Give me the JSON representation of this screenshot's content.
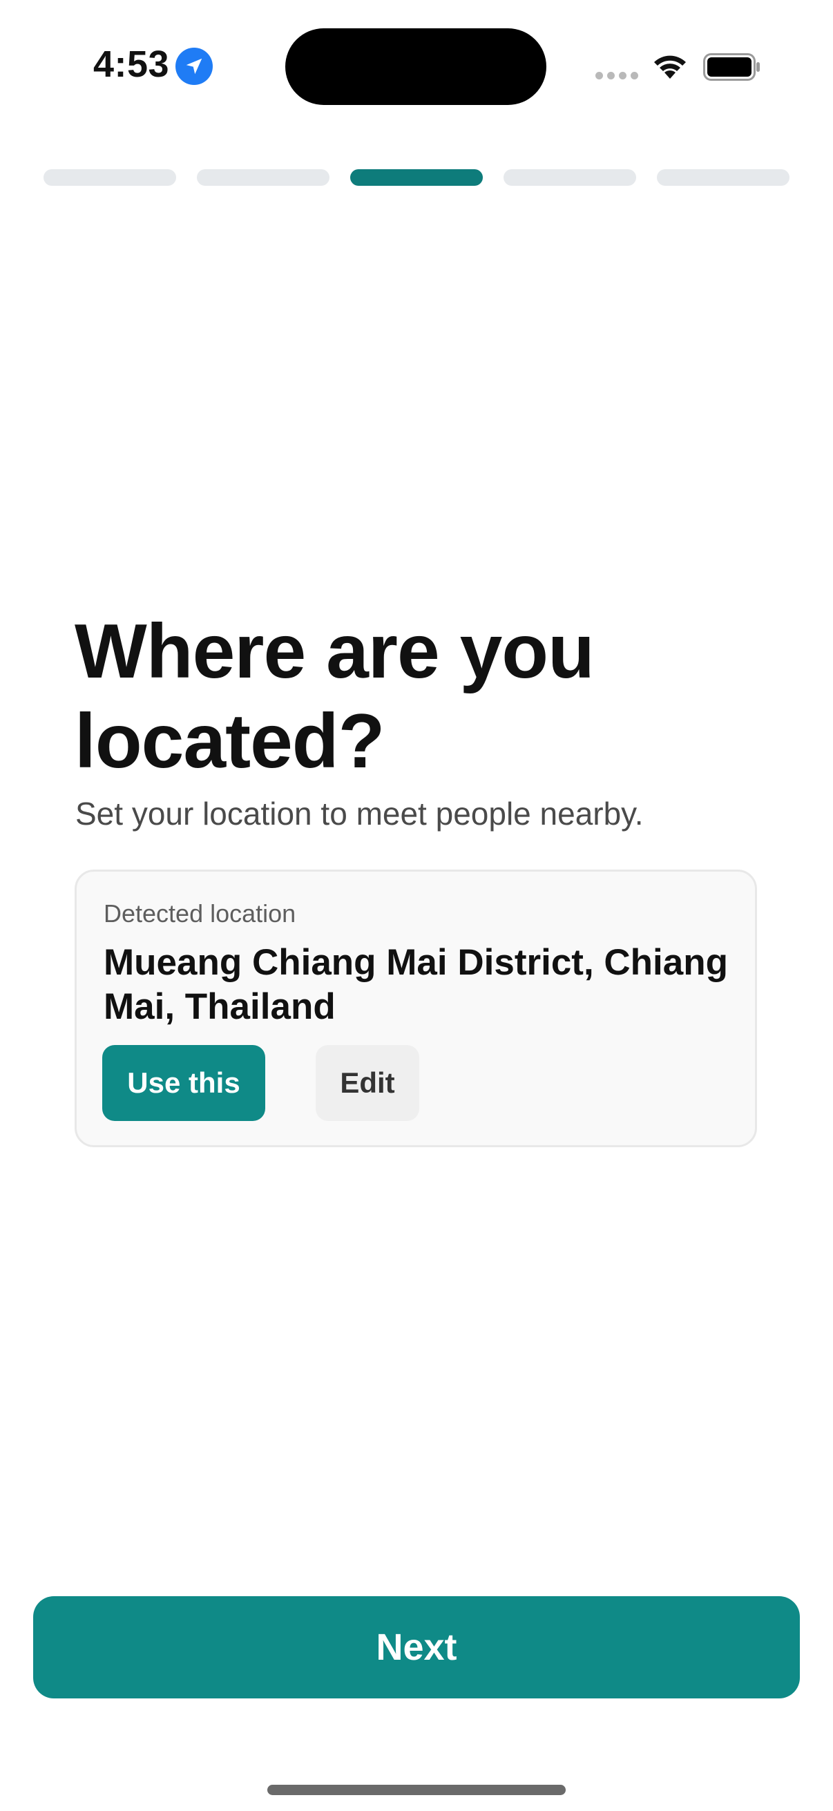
{
  "status_bar": {
    "time": "4:53",
    "location_icon": "location-arrow-icon",
    "signal_icon": "cellular-signal-icon",
    "wifi_icon": "wifi-icon",
    "battery_icon": "battery-icon"
  },
  "progress": {
    "total_steps": 5,
    "current_step": 3,
    "active_color": "#0e7c7b",
    "inactive_color": "#e6e9ec"
  },
  "heading": {
    "title": "Where are you located?",
    "subtitle": "Set your location to meet people nearby."
  },
  "location_card": {
    "label": "Detected location",
    "value": "Mueang Chiang Mai District, Chiang Mai, Thailand",
    "use_button": "Use this",
    "edit_button": "Edit"
  },
  "footer": {
    "next_button": "Next"
  },
  "colors": {
    "accent": "#0f8a87",
    "text_primary": "#111111",
    "text_secondary": "#4a4a4a"
  }
}
